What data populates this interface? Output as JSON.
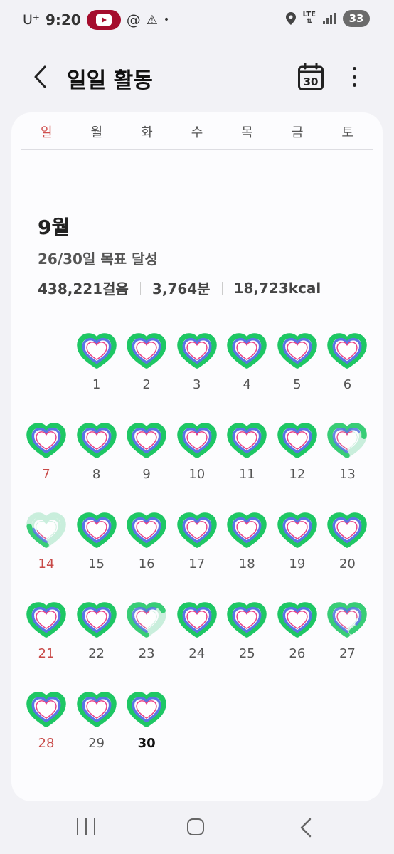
{
  "status_bar": {
    "carrier": "U⁺",
    "time": "9:20",
    "notification_icons": [
      "youtube-icon",
      "threads-icon",
      "warning-icon",
      "dot-icon"
    ],
    "right_icons": [
      "location-icon",
      "lte-icon",
      "signal-icon"
    ],
    "lte_label": "LTE",
    "battery": "33"
  },
  "header": {
    "title": "일일 활동",
    "calendar_icon_label": "30"
  },
  "weekdays": [
    "일",
    "월",
    "화",
    "수",
    "목",
    "금",
    "토"
  ],
  "summary": {
    "month": "9월",
    "goal": "26/30일 목표 달성",
    "steps": "438,221걸음",
    "minutes": "3,764분",
    "calories": "18,723kcal"
  },
  "calendar": {
    "first_weekday_index": 1,
    "today": "30",
    "days": [
      {
        "day": "1",
        "progress": 1.0
      },
      {
        "day": "2",
        "progress": 1.0
      },
      {
        "day": "3",
        "progress": 1.0
      },
      {
        "day": "4",
        "progress": 1.0
      },
      {
        "day": "5",
        "progress": 1.0
      },
      {
        "day": "6",
        "progress": 1.0
      },
      {
        "day": "7",
        "progress": 1.0
      },
      {
        "day": "8",
        "progress": 1.0
      },
      {
        "day": "9",
        "progress": 1.0
      },
      {
        "day": "10",
        "progress": 1.0
      },
      {
        "day": "11",
        "progress": 1.0
      },
      {
        "day": "12",
        "progress": 1.0
      },
      {
        "day": "13",
        "progress": 0.75
      },
      {
        "day": "14",
        "progress": 0.25
      },
      {
        "day": "15",
        "progress": 1.0
      },
      {
        "day": "16",
        "progress": 1.0
      },
      {
        "day": "17",
        "progress": 1.0
      },
      {
        "day": "18",
        "progress": 1.0
      },
      {
        "day": "19",
        "progress": 1.0
      },
      {
        "day": "20",
        "progress": 1.0
      },
      {
        "day": "21",
        "progress": 1.0
      },
      {
        "day": "22",
        "progress": 1.0
      },
      {
        "day": "23",
        "progress": 0.7
      },
      {
        "day": "24",
        "progress": 1.0
      },
      {
        "day": "25",
        "progress": 1.0
      },
      {
        "day": "26",
        "progress": 1.0
      },
      {
        "day": "27",
        "progress": 0.95
      },
      {
        "day": "28",
        "progress": 1.0
      },
      {
        "day": "29",
        "progress": 1.0
      },
      {
        "day": "30",
        "progress": 1.0
      }
    ]
  },
  "colors": {
    "ring_outer": "#1ec764",
    "ring_middle": "#5b74e6",
    "ring_inner": "#ec3f86",
    "ring_faded": "#c9eedc",
    "sunday": "#d0504f"
  },
  "nav_bar": [
    "recents-button",
    "home-button",
    "back-button"
  ]
}
